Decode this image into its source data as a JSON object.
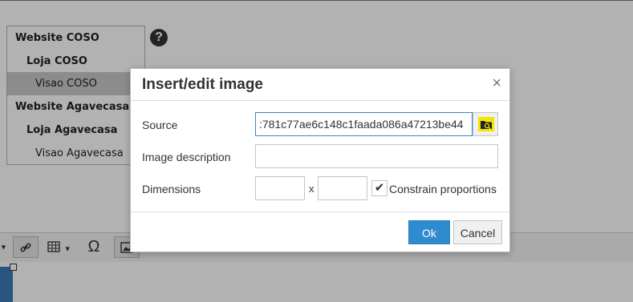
{
  "tree": {
    "items": [
      {
        "label": "Website COSO"
      },
      {
        "label": "Loja COSO"
      },
      {
        "label": "Visao COSO"
      },
      {
        "label": "Website Agavecasa"
      },
      {
        "label": "Loja Agavecasa"
      },
      {
        "label": "Visao Agavecasa"
      }
    ],
    "help_icon": "question-circle-icon"
  },
  "toolbar": {
    "omega_glyph": "Ω",
    "icons": [
      "link-icon",
      "table-icon",
      "special-character-icon",
      "image-icon"
    ]
  },
  "dialog": {
    "title": "Insert/edit image",
    "close_glyph": "×",
    "source_label": "Source",
    "source_value": ":781c77ae6c148c1faada086a47213be44",
    "description_label": "Image description",
    "description_value": "",
    "dimensions_label": "Dimensions",
    "width_value": "",
    "height_value": "",
    "x_separator": "x",
    "constrain_label": "Constrain proportions",
    "constrain_checked": true,
    "ok_label": "Ok",
    "cancel_label": "Cancel"
  }
}
